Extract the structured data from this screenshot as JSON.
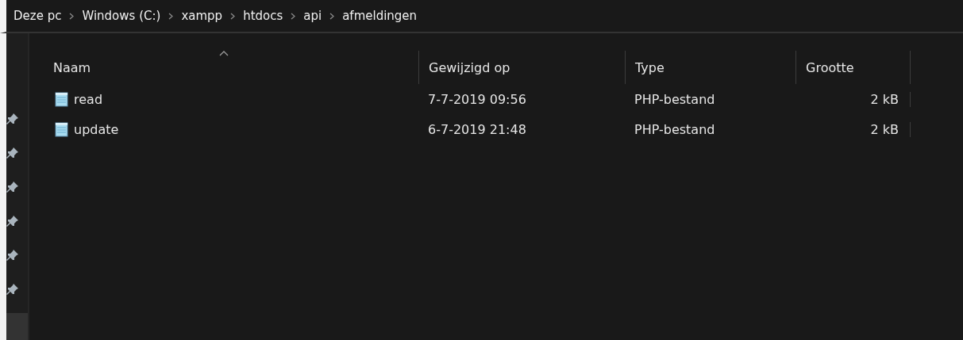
{
  "breadcrumbs": [
    "Deze pc",
    "Windows (C:)",
    "xampp",
    "htdocs",
    "api",
    "afmeldingen"
  ],
  "table": {
    "columns": [
      {
        "label": "Naam",
        "sorted": true
      },
      {
        "label": "Gewijzigd op",
        "sorted": false
      },
      {
        "label": "Type",
        "sorted": false
      },
      {
        "label": "Grootte",
        "sorted": false
      }
    ],
    "rows": [
      {
        "name": "read",
        "modified": "7-7-2019 09:56",
        "type": "PHP-bestand",
        "size": "2 kB"
      },
      {
        "name": "update",
        "modified": "6-7-2019 21:48",
        "type": "PHP-bestand",
        "size": "2 kB"
      }
    ]
  }
}
